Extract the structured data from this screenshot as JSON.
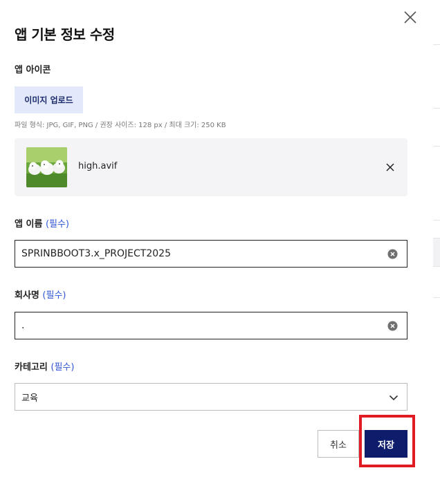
{
  "modal": {
    "title": "앱 기본 정보 수정",
    "close_icon": "close-icon"
  },
  "icon_section": {
    "label": "앱 아이콘",
    "upload_label": "이미지 업로드",
    "hint": "파일 형식: JPG, GIF, PNG / 권장 사이즈: 128 px / 최대 크기: 250 KB",
    "file": {
      "name": "high.avif",
      "thumbnail_icon": "puppies-thumbnail",
      "remove_icon": "close-icon"
    }
  },
  "app_name": {
    "label": "앱 이름",
    "required": "(필수)",
    "value": "SPRINBBOOT3.x_PROJECT2025",
    "clear_icon": "clear-circle-icon"
  },
  "company": {
    "label": "회사명",
    "required": "(필수)",
    "value": ".",
    "clear_icon": "clear-circle-icon"
  },
  "category": {
    "label": "카테고리",
    "required": "(필수)",
    "selected": "교육",
    "dropdown_icon": "chevron-down-icon"
  },
  "actions": {
    "cancel_label": "취소",
    "save_label": "저장"
  },
  "colors": {
    "primary": "#0d1c6b",
    "upload_bg": "#e3e8fa",
    "required_text": "#2f55d4",
    "highlight": "#e01b24"
  }
}
